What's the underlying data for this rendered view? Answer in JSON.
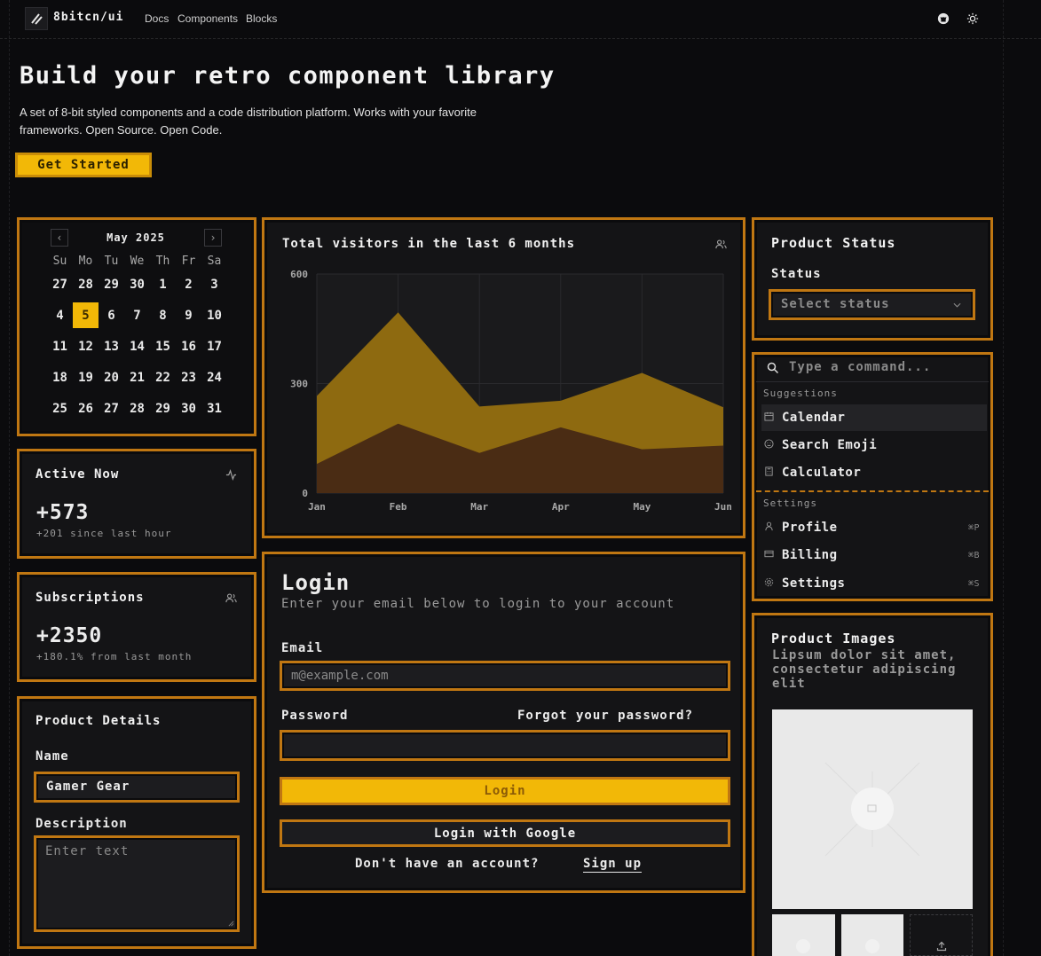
{
  "header": {
    "brand": "8bitcn/ui",
    "nav": [
      "Docs",
      "Components",
      "Blocks"
    ],
    "icons": [
      "github-icon",
      "theme-toggle-icon"
    ]
  },
  "hero": {
    "title": "Build your retro component library",
    "description": "A set of 8-bit styled components and a code distribution platform. Works with your favorite frameworks. Open Source. Open Code.",
    "cta": "Get Started"
  },
  "calendar": {
    "month": "May 2025",
    "prev_icon": "‹",
    "next_icon": "›",
    "day_headers": [
      "Su",
      "Mo",
      "Tu",
      "We",
      "Th",
      "Fr",
      "Sa"
    ],
    "weeks": [
      [
        "27",
        "28",
        "29",
        "30",
        "1",
        "2",
        "3"
      ],
      [
        "4",
        "5",
        "6",
        "7",
        "8",
        "9",
        "10"
      ],
      [
        "11",
        "12",
        "13",
        "14",
        "15",
        "16",
        "17"
      ],
      [
        "18",
        "19",
        "20",
        "21",
        "22",
        "23",
        "24"
      ],
      [
        "25",
        "26",
        "27",
        "28",
        "29",
        "30",
        "31"
      ]
    ],
    "selected": "5"
  },
  "active_now": {
    "title": "Active Now",
    "value": "+573",
    "sub": "+201 since last hour"
  },
  "subscriptions": {
    "title": "Subscriptions",
    "value": "+2350",
    "sub": "+180.1% from last month"
  },
  "product_details": {
    "title": "Product Details",
    "name_label": "Name",
    "name_value": "Gamer Gear",
    "desc_label": "Description",
    "desc_placeholder": "Enter text"
  },
  "chart_data": {
    "type": "area",
    "title": "Total visitors in the last 6 months",
    "categories": [
      "Jan",
      "Feb",
      "Mar",
      "Apr",
      "May",
      "Jun"
    ],
    "ylim": [
      0,
      600
    ],
    "yticks": [
      "600",
      "300",
      "0"
    ],
    "xlabel": "",
    "ylabel": "",
    "grid": true,
    "series": [
      {
        "values": [
          80,
          190,
          110,
          180,
          120,
          130
        ],
        "color": "#4a2c14"
      },
      {
        "values": [
          186,
          305,
          127,
          73,
          209,
          105
        ],
        "color": "#8e6a10"
      }
    ]
  },
  "login": {
    "title": "Login",
    "subtitle": "Enter your email below to login to your account",
    "email_label": "Email",
    "email_placeholder": "m@example.com",
    "password_label": "Password",
    "forgot": "Forgot your password?",
    "login_button": "Login",
    "google_button": "Login with Google",
    "no_account": "Don't have an account?",
    "signup": "Sign up"
  },
  "product_status": {
    "title": "Product Status",
    "label": "Status",
    "placeholder": "Select status"
  },
  "command": {
    "placeholder": "Type a command...",
    "groups": [
      {
        "heading": "Suggestions",
        "items": [
          {
            "label": "Calendar",
            "icon": "calendar-icon",
            "shortcut": ""
          },
          {
            "label": "Search Emoji",
            "icon": "smile-icon",
            "shortcut": ""
          },
          {
            "label": "Calculator",
            "icon": "calculator-icon",
            "shortcut": ""
          }
        ]
      },
      {
        "heading": "Settings",
        "items": [
          {
            "label": "Profile",
            "icon": "user-icon",
            "shortcut": "⌘P"
          },
          {
            "label": "Billing",
            "icon": "credit-card-icon",
            "shortcut": "⌘B"
          },
          {
            "label": "Settings",
            "icon": "gear-icon",
            "shortcut": "⌘S"
          }
        ]
      }
    ]
  },
  "product_images": {
    "title": "Product Images",
    "description": "Lipsum dolor sit amet, consectetur adipiscing elit"
  },
  "colors": {
    "accent": "#f2b807",
    "border": "#c07712",
    "background": "#0b0b0d"
  }
}
